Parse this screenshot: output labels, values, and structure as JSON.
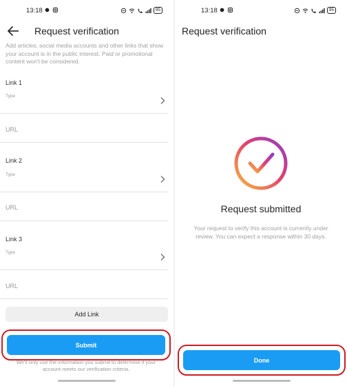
{
  "status_bar": {
    "time": "13:18",
    "battery": "95"
  },
  "left": {
    "title": "Request verification",
    "helper": "Add articles, social media accounts and other links that show your account is in the public interest. Paid or promotional content won't be considered.",
    "links": [
      {
        "label": "Link 1",
        "type_label": "Type",
        "url_placeholder": "URL"
      },
      {
        "label": "Link 2",
        "type_label": "Type",
        "url_placeholder": "URL"
      },
      {
        "label": "Link 3",
        "type_label": "Type",
        "url_placeholder": "URL"
      }
    ],
    "add_link_label": "Add Link",
    "submit_label": "Submit",
    "disclaimer": "We'll only use the information you submit to determine if your account meets our verification criteria."
  },
  "right": {
    "title": "Request verification",
    "heading": "Request submitted",
    "message": "Your request to verify this account is currently under review. You can expect a response within 30 days.",
    "done_label": "Done"
  },
  "colors": {
    "accent": "#1a9cf5",
    "highlight_ring": "#cc1d23",
    "gradient": [
      "#f7b93c",
      "#e4406f",
      "#8f3cc9"
    ]
  },
  "icons": [
    "back-arrow-icon",
    "chevron-right-icon",
    "check-badge-icon",
    "wifi-icon",
    "signal-icon",
    "battery-icon"
  ]
}
